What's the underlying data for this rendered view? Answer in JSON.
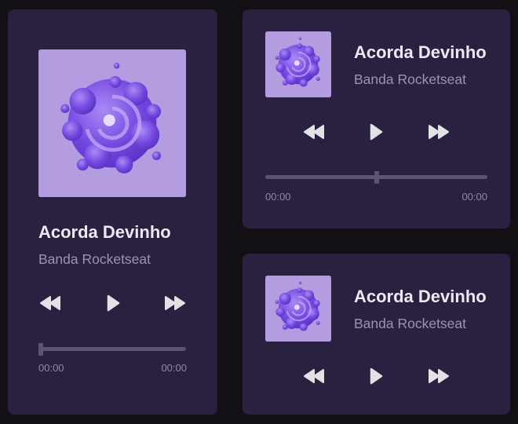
{
  "players": [
    {
      "title": "Acorda Devinho",
      "artist": "Banda Rocketseat",
      "time_current": "00:00",
      "time_total": "00:00",
      "progress": 0
    },
    {
      "title": "Acorda Devinho",
      "artist": "Banda Rocketseat",
      "time_current": "00:00",
      "time_total": "00:00",
      "progress": 0.5
    },
    {
      "title": "Acorda Devinho",
      "artist": "Banda Rocketseat"
    }
  ],
  "icons": {
    "prev": "rewind-icon",
    "play": "play-icon",
    "next": "fast-forward-icon"
  },
  "colors": {
    "background": "#121014",
    "card": "#2a2140",
    "accent": "#8257e5",
    "track": "#5c5470",
    "icon": "#e1e1e6"
  }
}
